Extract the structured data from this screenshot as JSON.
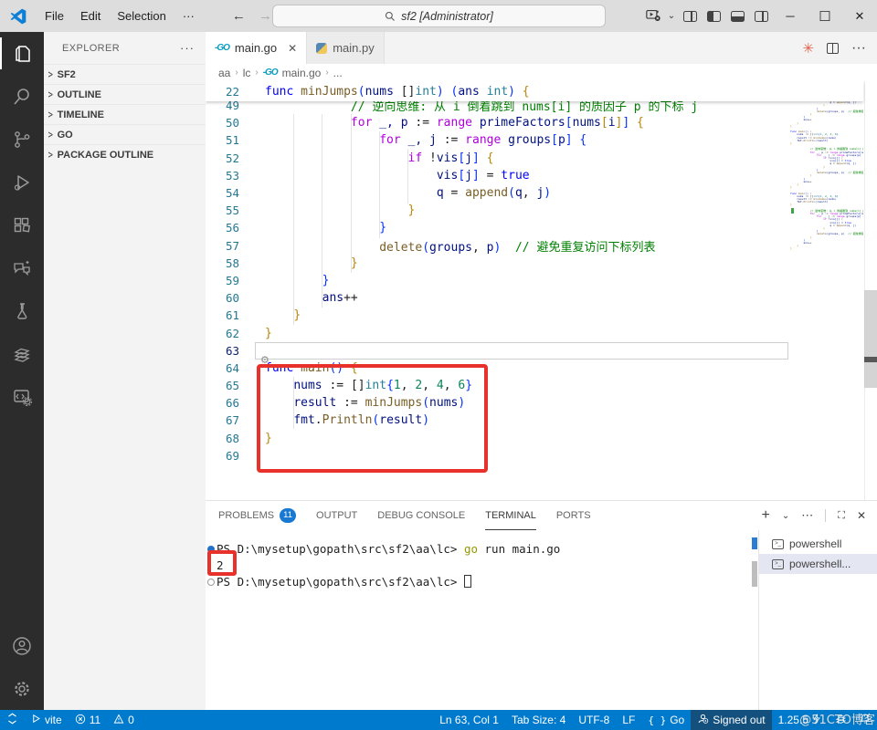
{
  "title_bar": {
    "menus": [
      "File",
      "Edit",
      "Selection",
      "···"
    ],
    "search_text": "sf2 [Administrator]",
    "window_controls": {
      "minimize": "─",
      "maximize": "☐",
      "close": "✕"
    }
  },
  "activity_bar": {
    "top_icons": [
      "explorer-icon",
      "search-icon",
      "source-control-icon",
      "run-debug-icon",
      "extensions-icon",
      "chat-icon",
      "testing-icon",
      "go-extension-icon",
      "code-runner-icon"
    ],
    "bottom_icons": [
      "account-icon",
      "settings-gear-icon"
    ],
    "active": "explorer-icon"
  },
  "sidebar": {
    "title": "EXPLORER",
    "more": "···",
    "sections": [
      {
        "label": "SF2"
      },
      {
        "label": "OUTLINE"
      },
      {
        "label": "TIMELINE"
      },
      {
        "label": "GO"
      },
      {
        "label": "PACKAGE OUTLINE"
      }
    ]
  },
  "editor": {
    "tabs": [
      {
        "label": "main.go",
        "icon": "go-icon",
        "active": true,
        "close": "✕"
      },
      {
        "label": "main.py",
        "icon": "python-icon",
        "active": false
      }
    ],
    "actions": {
      "runner": "✳",
      "more": "···"
    },
    "breadcrumb": [
      "aa",
      "lc",
      "main.go",
      "..."
    ],
    "sticky_line": {
      "num": "22",
      "segments": [
        [
          "func ",
          "d"
        ],
        [
          "minJumps",
          "f"
        ],
        [
          "(",
          "b"
        ],
        [
          "nums ",
          "v"
        ],
        [
          "[]",
          "p"
        ],
        [
          "int",
          "t"
        ],
        [
          ")",
          "b"
        ],
        [
          " ",
          "p"
        ],
        [
          "(",
          "b"
        ],
        [
          "ans ",
          "v"
        ],
        [
          "int",
          "t"
        ],
        [
          ")",
          "b"
        ],
        [
          " {",
          "g"
        ]
      ]
    },
    "lines": [
      {
        "num": "49",
        "segments": [
          [
            "            ",
            "p"
          ],
          [
            "// 逆向思维: 从 i 倒着跳到 nums[i] 的质因子 p 的下标 j",
            "c"
          ]
        ]
      },
      {
        "num": "50",
        "segments": [
          [
            "            ",
            "p"
          ],
          [
            "for",
            "k"
          ],
          [
            " _, p ",
            "v"
          ],
          [
            ":= ",
            "p"
          ],
          [
            "range",
            "k"
          ],
          [
            " primeFactors",
            "v"
          ],
          [
            "[",
            "b"
          ],
          [
            "nums",
            "v"
          ],
          [
            "[",
            "g"
          ],
          [
            "i",
            "v"
          ],
          [
            "]",
            "g"
          ],
          [
            "]",
            "b"
          ],
          [
            " {",
            "g"
          ]
        ]
      },
      {
        "num": "51",
        "segments": [
          [
            "                ",
            "p"
          ],
          [
            "for",
            "k"
          ],
          [
            " _, j ",
            "v"
          ],
          [
            ":= ",
            "p"
          ],
          [
            "range",
            "k"
          ],
          [
            " groups",
            "v"
          ],
          [
            "[",
            "b"
          ],
          [
            "p",
            "v"
          ],
          [
            "]",
            "b"
          ],
          [
            " {",
            "b"
          ]
        ]
      },
      {
        "num": "52",
        "segments": [
          [
            "                    ",
            "p"
          ],
          [
            "if ",
            "k"
          ],
          [
            "!",
            "p"
          ],
          [
            "vis",
            "v"
          ],
          [
            "[",
            "b"
          ],
          [
            "j",
            "v"
          ],
          [
            "]",
            "b"
          ],
          [
            " {",
            "g"
          ]
        ]
      },
      {
        "num": "53",
        "segments": [
          [
            "                        ",
            "p"
          ],
          [
            "vis",
            "v"
          ],
          [
            "[",
            "b"
          ],
          [
            "j",
            "v"
          ],
          [
            "]",
            "b"
          ],
          [
            " = ",
            "p"
          ],
          [
            "true",
            "d"
          ]
        ]
      },
      {
        "num": "54",
        "segments": [
          [
            "                        ",
            "p"
          ],
          [
            "q",
            "v"
          ],
          [
            " = ",
            "p"
          ],
          [
            "append",
            "f"
          ],
          [
            "(",
            "b"
          ],
          [
            "q",
            "v"
          ],
          [
            ", ",
            "p"
          ],
          [
            "j",
            "v"
          ],
          [
            ")",
            "b"
          ]
        ]
      },
      {
        "num": "55",
        "segments": [
          [
            "                    ",
            "p"
          ],
          [
            "}",
            "g"
          ]
        ]
      },
      {
        "num": "56",
        "segments": [
          [
            "                ",
            "p"
          ],
          [
            "}",
            "b"
          ]
        ]
      },
      {
        "num": "57",
        "segments": [
          [
            "                ",
            "p"
          ],
          [
            "delete",
            "f"
          ],
          [
            "(",
            "b"
          ],
          [
            "groups",
            "v"
          ],
          [
            ", ",
            "p"
          ],
          [
            "p",
            "v"
          ],
          [
            ")",
            "b"
          ],
          [
            "  ",
            "p"
          ],
          [
            "// 避免重复访问下标列表",
            "c"
          ]
        ]
      },
      {
        "num": "58",
        "segments": [
          [
            "            ",
            "p"
          ],
          [
            "}",
            "g"
          ]
        ]
      },
      {
        "num": "59",
        "segments": [
          [
            "        ",
            "p"
          ],
          [
            "}",
            "b"
          ]
        ]
      },
      {
        "num": "60",
        "segments": [
          [
            "        ",
            "p"
          ],
          [
            "ans",
            "v"
          ],
          [
            "++",
            "p"
          ]
        ]
      },
      {
        "num": "61",
        "segments": [
          [
            "    ",
            "p"
          ],
          [
            "}",
            "g"
          ]
        ]
      },
      {
        "num": "62",
        "segments": [
          [
            "}",
            "g"
          ]
        ]
      },
      {
        "num": "63",
        "segments": []
      },
      {
        "num": "64",
        "segments": [
          [
            "func ",
            "d"
          ],
          [
            "main",
            "f"
          ],
          [
            "(",
            "b"
          ],
          [
            ")",
            "b"
          ],
          [
            " {",
            "g"
          ]
        ]
      },
      {
        "num": "65",
        "segments": [
          [
            "    ",
            "p"
          ],
          [
            "nums",
            "v"
          ],
          [
            " := ",
            "p"
          ],
          [
            "[]",
            "p"
          ],
          [
            "int",
            "t"
          ],
          [
            "{",
            "b"
          ],
          [
            "1",
            "n"
          ],
          [
            ", ",
            "p"
          ],
          [
            "2",
            "n"
          ],
          [
            ", ",
            "p"
          ],
          [
            "4",
            "n"
          ],
          [
            ", ",
            "p"
          ],
          [
            "6",
            "n"
          ],
          [
            "}",
            "b"
          ]
        ]
      },
      {
        "num": "66",
        "segments": [
          [
            "    ",
            "p"
          ],
          [
            "result",
            "v"
          ],
          [
            " := ",
            "p"
          ],
          [
            "minJumps",
            "f"
          ],
          [
            "(",
            "b"
          ],
          [
            "nums",
            "v"
          ],
          [
            ")",
            "b"
          ]
        ]
      },
      {
        "num": "67",
        "segments": [
          [
            "    ",
            "p"
          ],
          [
            "fmt",
            "v"
          ],
          [
            ".",
            "p"
          ],
          [
            "Println",
            "f"
          ],
          [
            "(",
            "b"
          ],
          [
            "result",
            "v"
          ],
          [
            ")",
            "b"
          ]
        ]
      },
      {
        "num": "68",
        "segments": [
          [
            "}",
            "g"
          ]
        ]
      },
      {
        "num": "69",
        "segments": []
      }
    ],
    "cursor_line": "63"
  },
  "panel": {
    "tabs": [
      {
        "label": "PROBLEMS",
        "badge": "11",
        "active": false
      },
      {
        "label": "OUTPUT",
        "active": false
      },
      {
        "label": "DEBUG CONSOLE",
        "active": false
      },
      {
        "label": "TERMINAL",
        "active": true
      },
      {
        "label": "PORTS",
        "active": false
      }
    ],
    "actions": [
      "plus-icon",
      "chevron-down-icon",
      "more-icon",
      "maximize-panel-icon",
      "close-panel-icon"
    ],
    "terminal": {
      "lines": [
        {
          "deco": "filled",
          "segments": [
            [
              "PS D:\\mysetup\\gopath\\src\\sf2\\aa\\lc> ",
              "p"
            ],
            [
              "go",
              "pgo"
            ],
            [
              " run main.go",
              "p"
            ]
          ]
        },
        {
          "deco": "none",
          "segments": [
            [
              "2",
              "p"
            ]
          ]
        },
        {
          "deco": "hollow",
          "segments": [
            [
              "PS D:\\mysetup\\gopath\\src\\sf2\\aa\\lc> ",
              "p"
            ]
          ],
          "cursor": true
        }
      ]
    },
    "terminal_list": [
      {
        "label": "powershell",
        "selected": false
      },
      {
        "label": "powershell...",
        "selected": true
      }
    ]
  },
  "status_bar": {
    "left": [
      {
        "icon": "remote-icon",
        "label": ""
      },
      {
        "icon": "play-icon",
        "label": "vite"
      },
      {
        "icon": "error-icon",
        "label": "11"
      },
      {
        "icon": "warning-icon",
        "label": "0"
      }
    ],
    "right": [
      {
        "label": "Ln 63, Col 1"
      },
      {
        "label": "Tab Size: 4"
      },
      {
        "label": "UTF-8"
      },
      {
        "label": "LF"
      },
      {
        "icon": "braces-icon",
        "label": "Go"
      },
      {
        "icon": "account-icon",
        "label": "Signed out",
        "dark": true
      },
      {
        "label": "1.25.5",
        "icon_after": "zap-icon"
      },
      {
        "icon": "gopher-icon",
        "label": ""
      },
      {
        "icon": "bell-icon",
        "label": ""
      }
    ]
  },
  "annotations": {
    "color": "#e8312b"
  },
  "watermark": "@51CTO博客",
  "colors": {
    "accent": "#007acc",
    "badge": "#1878d2",
    "titlebar": "#dddddd",
    "activitybar": "#2c2c2c"
  }
}
